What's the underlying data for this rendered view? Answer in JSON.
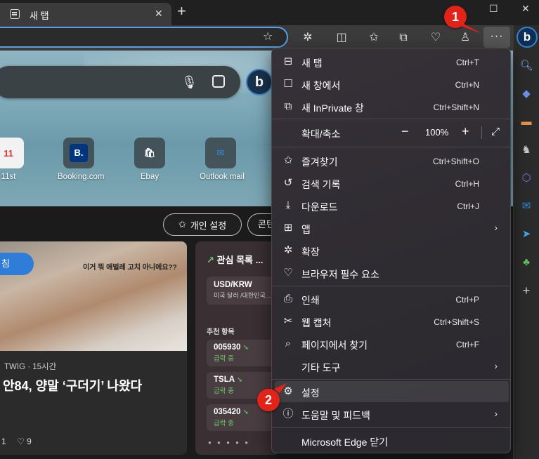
{
  "tab": {
    "title": "새 탭",
    "close": "✕",
    "new_tab": "+"
  },
  "window": {
    "maximize": "☐",
    "close": "✕"
  },
  "toolbar": {
    "more_label": "···",
    "icons": [
      "star-icon",
      "extensions-icon",
      "split-screen-icon",
      "favorites-icon",
      "collections-icon",
      "browser-essentials-icon",
      "profile-icon"
    ]
  },
  "hero": {
    "quicklinks": [
      {
        "label": "11st",
        "tile": "11"
      },
      {
        "label": "Booking.com",
        "tile": "B."
      },
      {
        "label": "Ebay",
        "tile": "🛍"
      },
      {
        "label": "Outlook mail",
        "tile": "✉"
      }
    ]
  },
  "buttons": {
    "personal": "개인 설정",
    "content": "콘텐"
  },
  "news": {
    "pill": "침",
    "caption": "이거 뭐 애벌레 고치 아니에요??",
    "source": "TWIG · 15시간",
    "title": "안84, 양말 ‘구더기’ 나왔다",
    "likes": "1",
    "dislikes": "9"
  },
  "watchlist": {
    "title": "관심 목록 ...",
    "item": {
      "symbol": "USD/KRW",
      "sub": "미국 달러 /대한민국..."
    },
    "recommended": "추천 항목",
    "stocks": [
      {
        "symbol": "005930",
        "status": "급락 중"
      },
      {
        "symbol": "TSLA",
        "status": "급락 중"
      },
      {
        "symbol": "035420",
        "status": "급락 중"
      }
    ]
  },
  "menu": {
    "items": [
      {
        "label": "새 탭",
        "shortcut": "Ctrl+T"
      },
      {
        "label": "새 창에서",
        "shortcut": "Ctrl+N"
      },
      {
        "label": "새 InPrivate 창",
        "shortcut": "Ctrl+Shift+N"
      },
      {
        "label": "확대/축소",
        "zoom": "100%"
      },
      {
        "label": "즐겨찾기",
        "shortcut": "Ctrl+Shift+O"
      },
      {
        "label": "검색 기록",
        "shortcut": "Ctrl+H"
      },
      {
        "label": "다운로드",
        "shortcut": "Ctrl+J"
      },
      {
        "label": "앱"
      },
      {
        "label": "확장"
      },
      {
        "label": "브라우저 필수 요소"
      },
      {
        "label": "인쇄",
        "shortcut": "Ctrl+P"
      },
      {
        "label": "웹 캡처",
        "shortcut": "Ctrl+Shift+S"
      },
      {
        "label": "페이지에서 찾기",
        "shortcut": "Ctrl+F"
      },
      {
        "label": "기타 도구"
      },
      {
        "label": "설정"
      },
      {
        "label": "도움말 및 피드백"
      },
      {
        "label": "Microsoft Edge 닫기"
      }
    ]
  },
  "badges": {
    "step1": "1",
    "step2": "2"
  },
  "colors": {
    "accent": "#2f7dd8",
    "badge": "#e2231a",
    "positive": "#6bcf6b"
  }
}
